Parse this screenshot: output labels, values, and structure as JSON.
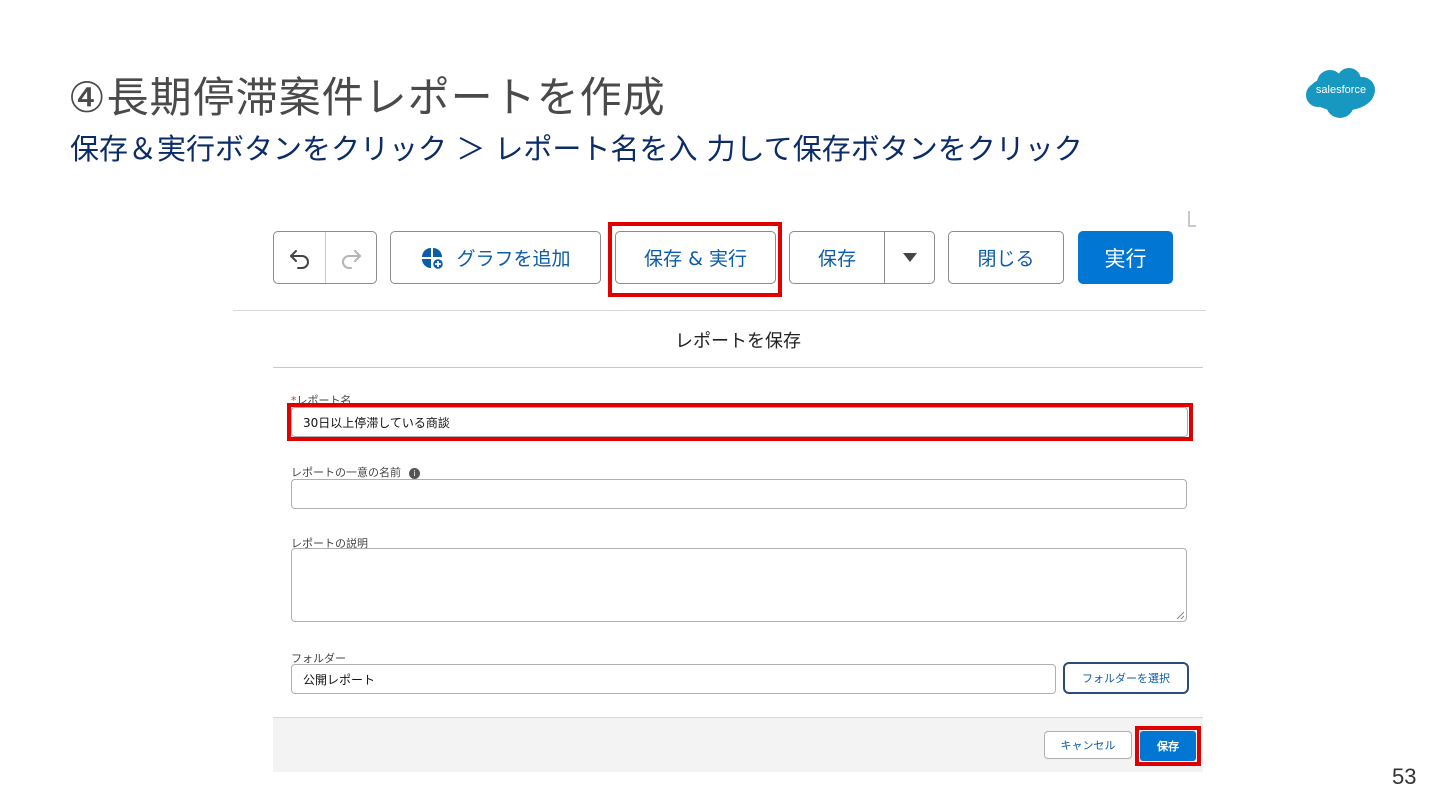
{
  "slide": {
    "title": "④長期停滞案件レポートを作成",
    "subtitle": "保存＆実行ボタンをクリック ＞ レポート名を入 力して保存ボタンをクリック",
    "logo_text": "salesforce",
    "page_number": "53"
  },
  "toolbar": {
    "undo_icon": "undo-icon",
    "redo_icon": "redo-icon",
    "add_chart_icon": "chart-add-icon",
    "add_chart_label": "グラフを追加",
    "save_run_label": "保存 & 実行",
    "save_label": "保存",
    "save_menu_icon": "caret-down-icon",
    "close_label": "閉じる",
    "run_label": "実行"
  },
  "modal": {
    "title": "レポートを保存",
    "report_name": {
      "required_mark": "*",
      "label": "レポート名",
      "value": "30日以上停滞している商談"
    },
    "unique_name": {
      "label": "レポートの一意の名前",
      "info_icon": "i",
      "value": ""
    },
    "description": {
      "label": "レポートの説明",
      "value": ""
    },
    "folder": {
      "label": "フォルダー",
      "value": "公開レポート",
      "select_button": "フォルダーを選択"
    },
    "cancel_label": "キャンセル",
    "save_label": "保存"
  },
  "colors": {
    "brand_blue": "#0176d3",
    "highlight_red": "#e00000",
    "subtitle_navy": "#0b2c66"
  }
}
